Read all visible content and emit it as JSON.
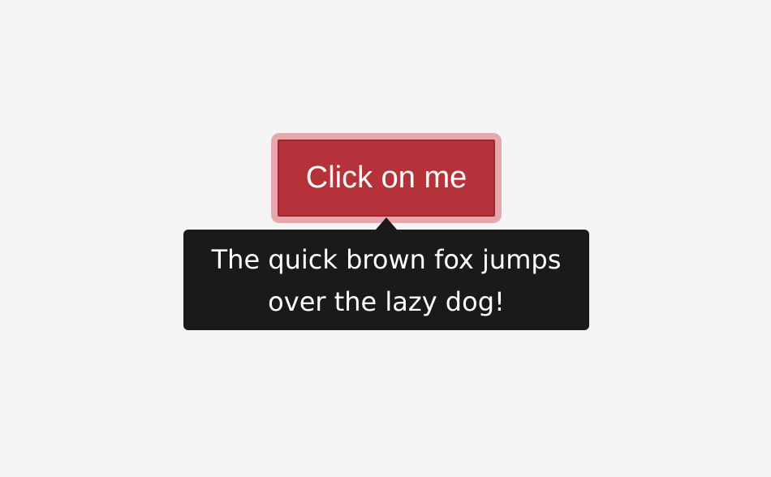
{
  "button": {
    "label": "Click on me"
  },
  "tooltip": {
    "line1": "The quick brown fox jumps",
    "line2": "over the lazy dog!"
  },
  "colors": {
    "background": "#f5f5f5",
    "button": "#b6323a",
    "focus_ring": "#e6a7ad",
    "tooltip": "#1a1a1a",
    "text": "#ffffff"
  }
}
